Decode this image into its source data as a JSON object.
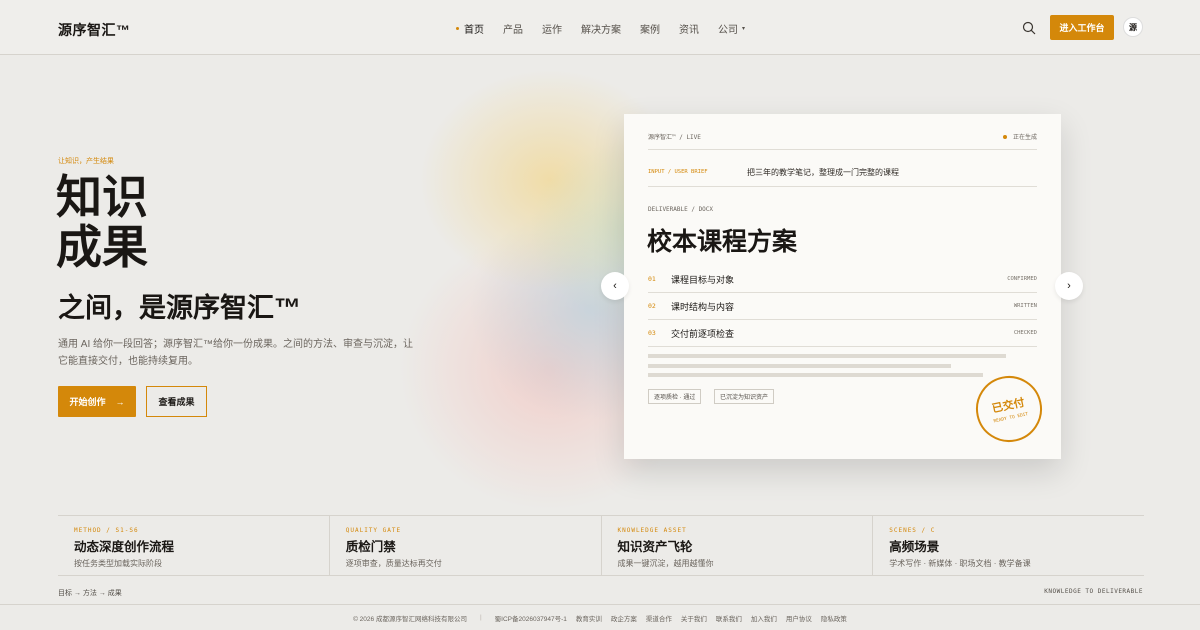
{
  "header": {
    "logo": "源序智汇™",
    "nav": [
      {
        "label": "首页",
        "active": true
      },
      {
        "label": "产品"
      },
      {
        "label": "运作"
      },
      {
        "label": "解决方案"
      },
      {
        "label": "案例"
      },
      {
        "label": "资讯"
      },
      {
        "label": "公司",
        "dropdown": true
      }
    ],
    "cta": "进入工作台",
    "avatar": "源"
  },
  "hero": {
    "eyebrow": "让知识，产生结果",
    "title_line1": "知识",
    "title_line2": "成果",
    "subtitle": "之间，是源序智汇™",
    "description": "通用 AI 给你一段回答；源序智汇™给你一份成果。之间的方法、审查与沉淀，让它能直接交付，也能持续复用。",
    "primary_button": "开始创作",
    "primary_arrow": "→",
    "secondary_button": "查看成果"
  },
  "card": {
    "tag": "源序智汇™ / LIVE",
    "status": "正在生成",
    "brief_label": "INPUT / USER BRIEF",
    "brief_text": "把三年的教学笔记，整理成一门完整的课程",
    "deliverable_label": "DELIVERABLE / DOCX",
    "title": "校本课程方案",
    "items": [
      {
        "num": "01",
        "label": "课程目标与对象",
        "state": "CONFIRMED"
      },
      {
        "num": "02",
        "label": "课时结构与内容",
        "state": "WRITTEN"
      },
      {
        "num": "03",
        "label": "交付前逐项检查",
        "state": "CHECKED"
      }
    ],
    "pills": [
      "逐项质检 · 通过",
      "已沉淀为知识资产"
    ],
    "stamp_main": "已交付",
    "stamp_sub": "READY TO EDIT",
    "prev_arrow": "‹",
    "next_arrow": "›"
  },
  "features": [
    {
      "label": "METHOD / S1-S6",
      "title": "动态深度创作流程",
      "desc": "按任务类型加载实际阶段"
    },
    {
      "label": "QUALITY GATE",
      "title": "质检门禁",
      "desc": "逐项审查，质量达标再交付"
    },
    {
      "label": "KNOWLEDGE ASSET",
      "title": "知识资产飞轮",
      "desc": "成果一键沉淀，越用越懂你"
    },
    {
      "label": "SCENES / C",
      "title": "高频场景",
      "desc": "学术写作 · 新媒体 · 职场文档 · 教学备课"
    }
  ],
  "breadcrumb": "目标 → 方法 → 成果",
  "tagline": "KNOWLEDGE TO DELIVERABLE",
  "footer": {
    "copyright": "© 2026 成都源序智汇网络科技有限公司",
    "icp": "蜀ICP备2026037947号-1",
    "links": [
      "教育实训",
      "政企方案",
      "渠道合作",
      "关于我们",
      "联系我们",
      "加入我们",
      "用户协议",
      "隐私政策"
    ]
  },
  "colors": {
    "accent": "#d4880a",
    "background": "#ecebe8",
    "card": "#fbfaf7"
  }
}
